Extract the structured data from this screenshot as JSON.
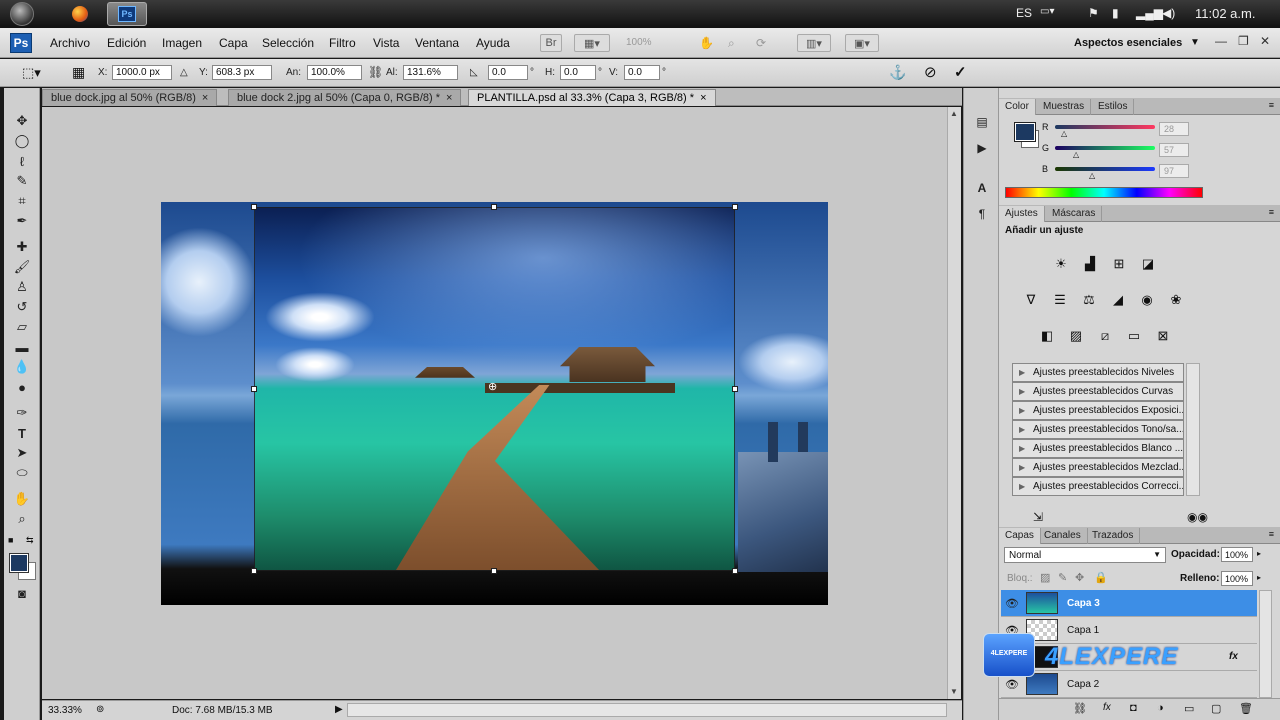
{
  "taskbar": {
    "lang": "ES",
    "clock": "11:02 a.m.",
    "photoshop_task_label": "Ps"
  },
  "app": {
    "logo": "Ps",
    "menus": [
      "Archivo",
      "Edición",
      "Imagen",
      "Capa",
      "Selección",
      "Filtro",
      "Vista",
      "Ventana",
      "Ayuda"
    ],
    "zoom_display": "100%",
    "workspace": "Aspectos esenciales"
  },
  "options": {
    "x_label": "X:",
    "x_value": "1000.0 px",
    "y_label": "Y:",
    "y_value": "608.3 px",
    "an_label": "An:",
    "an_value": "100.0%",
    "al_label": "Al:",
    "al_value": "131.6%",
    "angle_value": "0.0",
    "h_label": "H:",
    "h_value": "0.0",
    "v_label": "V:",
    "v_value": "0.0",
    "deg": "°"
  },
  "tabs": [
    {
      "label": "blue dock.jpg al 50% (RGB/8)",
      "close": "×"
    },
    {
      "label": "blue dock 2.jpg al 50% (Capa 0, RGB/8) *",
      "close": "×"
    },
    {
      "label": "PLANTILLA.psd al 33.3% (Capa 3, RGB/8) *",
      "close": "×"
    }
  ],
  "status": {
    "zoom": "33.33%",
    "doc": "Doc: 7.68 MB/15.3 MB"
  },
  "color_panel": {
    "tabs": [
      "Color",
      "Muestras",
      "Estilos"
    ],
    "r_label": "R",
    "r_value": "28",
    "g_label": "G",
    "g_value": "57",
    "b_label": "B",
    "b_value": "97",
    "fg_color": "#1c3961"
  },
  "adjust_panel": {
    "tabs": [
      "Ajustes",
      "Máscaras"
    ],
    "title": "Añadir un ajuste",
    "presets": [
      "Ajustes preestablecidos Niveles",
      "Ajustes preestablecidos Curvas",
      "Ajustes preestablecidos Exposici...",
      "Ajustes preestablecidos Tono/sa...",
      "Ajustes preestablecidos Blanco ...",
      "Ajustes preestablecidos Mezclad...",
      "Ajustes preestablecidos Correcci..."
    ]
  },
  "layers_panel": {
    "tabs": [
      "Capas",
      "Canales",
      "Trazados"
    ],
    "blend_mode": "Normal",
    "opacity_label": "Opacidad:",
    "opacity_value": "100%",
    "lock_label": "Bloq.:",
    "fill_label": "Relleno:",
    "fill_value": "100%",
    "layers": [
      {
        "name": "Capa 3",
        "selected": true
      },
      {
        "name": "Capa 1",
        "selected": false
      },
      {
        "name": "",
        "selected": false
      },
      {
        "name": "Capa 2",
        "selected": false
      }
    ],
    "fx": "fx"
  },
  "watermark": {
    "badge": "4LEXPERE",
    "text": "4LEXPERE"
  }
}
